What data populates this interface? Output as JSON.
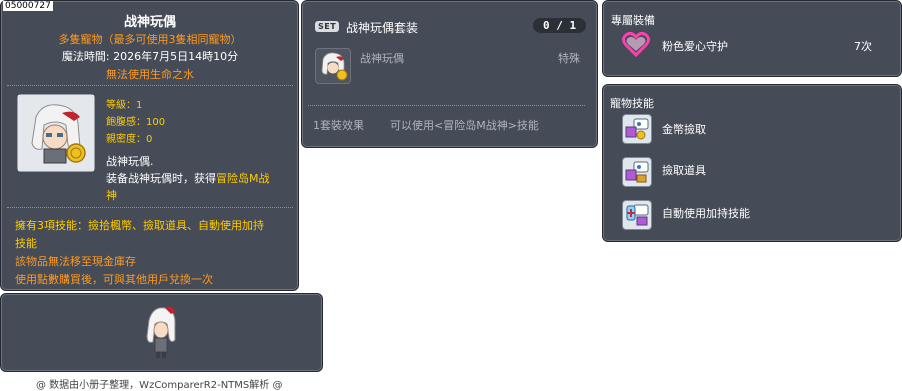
{
  "item": {
    "id": "05000727",
    "name": "战神玩偶",
    "pet_rule": "多隻寵物（最多可使用3隻相同寵物）",
    "magic_time": "魔法時間:  2026年7月5日14時10分",
    "no_life_water": "無法使用生命之水",
    "stats": {
      "level": "等級：1",
      "fullness": "飽腹感：100",
      "closeness": "親密度：0"
    },
    "desc_line1": "战神玩偶.",
    "desc_line2_prefix": "装备战神玩偶时，获得",
    "desc_line2_highlight": "冒险岛M战",
    "desc_line3_highlight": "神",
    "skills_note_line1": "擁有3項技能：撿拾楓幣、撿取道具、自動使用加持",
    "skills_note_line2": "技能",
    "storage_note": "該物品無法移至現金庫存",
    "trade_note": "使用點數購買後，可與其他用戶兌換一次"
  },
  "set": {
    "badge": "SET",
    "name": "战神玩偶套装",
    "count": "0 / 1",
    "piece_name": "战神玩偶",
    "piece_type": "特殊",
    "effect_label": "1套裝效果",
    "effect_text": "可以使用<冒险岛M战神>技能"
  },
  "exclusive": {
    "title": "專屬裝備",
    "item_name": "粉色爱心守护",
    "item_count": "7次",
    "icon": "pink-heart-icon"
  },
  "pet_skills": {
    "title": "寵物技能",
    "items": [
      {
        "label": "金幣撿取",
        "icon": "coin-pickup-icon"
      },
      {
        "label": "撿取道具",
        "icon": "item-pickup-icon"
      },
      {
        "label": "自動使用加持技能",
        "icon": "auto-buff-icon"
      }
    ]
  },
  "footer": "@ 数据由小册子整理，WzComparerR2-NTMS解析 @",
  "colors": {
    "panel_bg": "#454b57",
    "orange": "#ff9a1f",
    "yellow": "#ffcc00",
    "gray_text": "#b0b4bc"
  }
}
